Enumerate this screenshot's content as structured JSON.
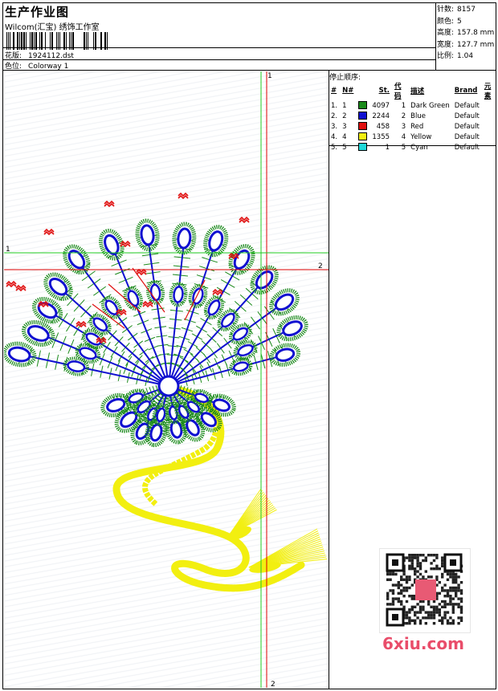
{
  "header": {
    "title": "生产作业图",
    "company": "Wilcom(汇宝) 绣饰工作室",
    "design_label": "花版:",
    "design_value": "1924112.dst",
    "colorway_label": "色位:",
    "colorway_value": "Colorway 1"
  },
  "stats": {
    "stitches_label": "针数:",
    "stitches": "8157",
    "colors_label": "颜色:",
    "colors": "5",
    "height_label": "高度:",
    "height": "157.8 mm",
    "width_label": "宽度:",
    "width": "127.7 mm",
    "scale_label": "比例:",
    "scale": "1.04"
  },
  "stop_sequence": {
    "title": "停止顺序:",
    "headers": [
      "#",
      "N#",
      "St.",
      "代码",
      "描述",
      "Brand",
      "元素"
    ],
    "rows": [
      {
        "num": "1.",
        "n": "1",
        "color": "#1a8a1a",
        "st": "4097",
        "code": "1",
        "desc": "Dark Green",
        "brand": "Default"
      },
      {
        "num": "2.",
        "n": "2",
        "color": "#1010d0",
        "st": "2244",
        "code": "2",
        "desc": "Blue",
        "brand": "Default"
      },
      {
        "num": "3.",
        "n": "3",
        "color": "#e01010",
        "st": "458",
        "code": "3",
        "desc": "Red",
        "brand": "Default"
      },
      {
        "num": "4.",
        "n": "4",
        "color": "#f2ef10",
        "st": "1355",
        "code": "4",
        "desc": "Yellow",
        "brand": "Default"
      },
      {
        "num": "5.",
        "n": "5",
        "color": "#20d8d8",
        "st": "1",
        "code": "5",
        "desc": "Cyan",
        "brand": "Default"
      }
    ]
  },
  "guides": {
    "green_top": "1",
    "red_top": "1",
    "green_left": "1",
    "red_right": "2",
    "red_bottom": "2"
  },
  "watermark": "6xiu.com",
  "colors": {
    "dark_green": "#1a8a1a",
    "blue": "#1010d0",
    "red": "#e01010",
    "yellow": "#f2ef10",
    "guide_green": "#22cc22",
    "guide_red": "#dd0000"
  }
}
